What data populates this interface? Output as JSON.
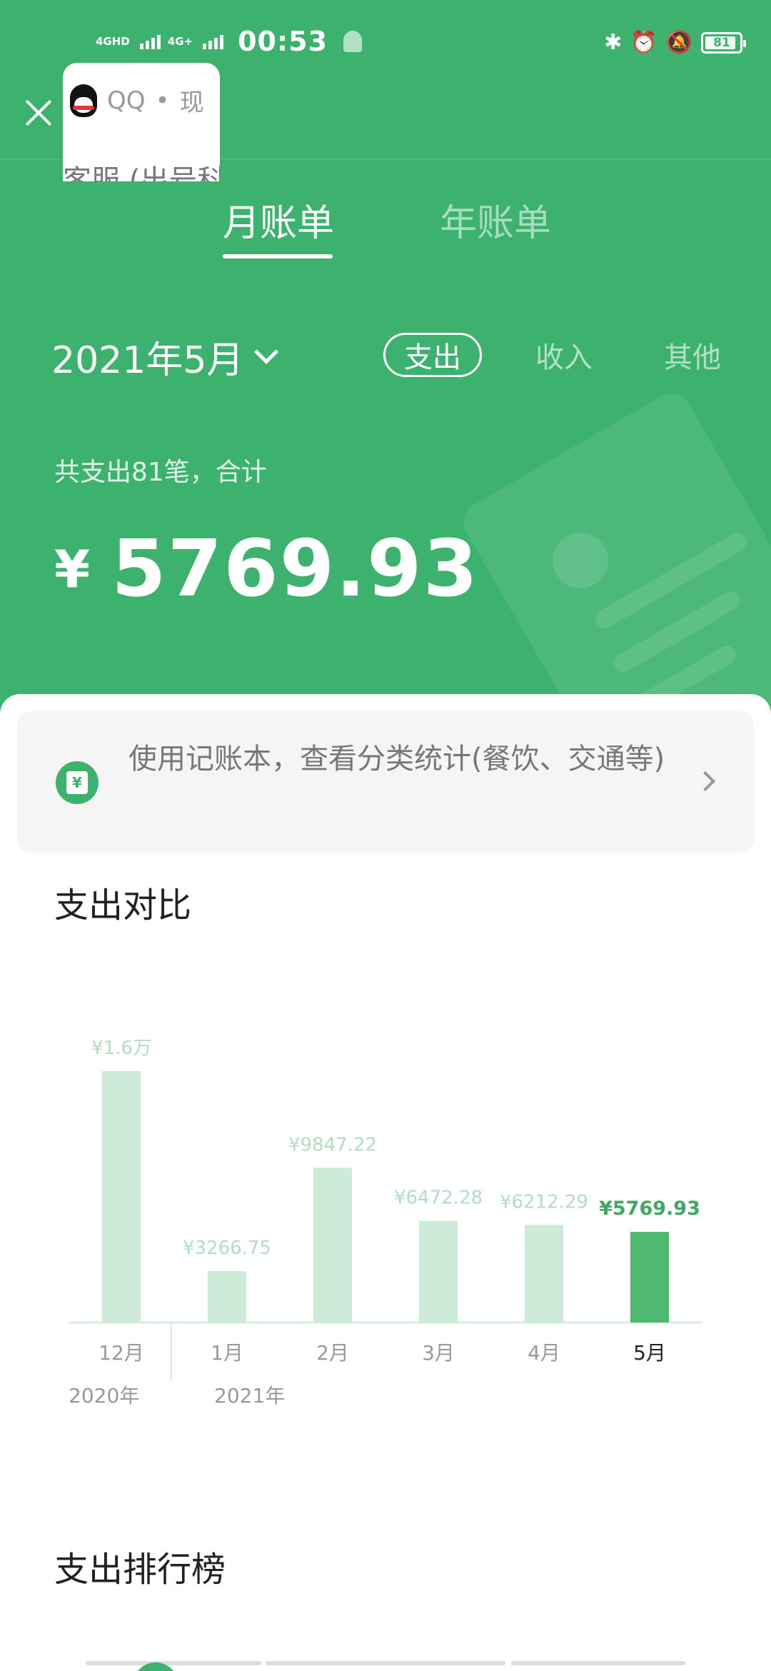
{
  "status_bar": {
    "network1": "4GHD",
    "network2": "4G+",
    "time": "00:53",
    "battery": "81"
  },
  "overlay": {
    "app_name": "QQ",
    "separator": "•",
    "app_suffix": "现",
    "subtitle": "客服 (出号科"
  },
  "tabs": {
    "month": "月账单",
    "year": "年账单"
  },
  "period": {
    "label": "2021年5月"
  },
  "type_filters": {
    "expense": "支出",
    "income": "收入",
    "other": "其他"
  },
  "summary": {
    "label": "共支出81笔，合计",
    "currency": "¥",
    "amount": "5769.93"
  },
  "notebook_banner": {
    "text": "使用记账本，查看分类统计(餐饮、交通等)"
  },
  "sections": {
    "comparison_title": "支出对比",
    "ranking_title": "支出排行榜"
  },
  "chart_data": {
    "type": "bar",
    "title": "支出对比",
    "categories": [
      "12月",
      "1月",
      "2月",
      "3月",
      "4月",
      "5月"
    ],
    "values": [
      16000,
      3266.75,
      9847.22,
      6472.28,
      6212.29,
      5769.93
    ],
    "value_labels": [
      "¥1.6万",
      "¥3266.75",
      "¥9847.22",
      "¥6472.28",
      "¥6212.29",
      "¥5769.93"
    ],
    "year_labels": [
      "2020年",
      "2021年"
    ],
    "highlight_index": 5,
    "colors": {
      "bar": "#cdebd8",
      "highlight": "#4fba6f",
      "label": "#b4dcc3",
      "highlight_label": "#3ea763",
      "axis": "#d7ede0"
    },
    "grid": false
  },
  "colors": {
    "brand": "#3db26f",
    "sheet": "#ffffff"
  }
}
